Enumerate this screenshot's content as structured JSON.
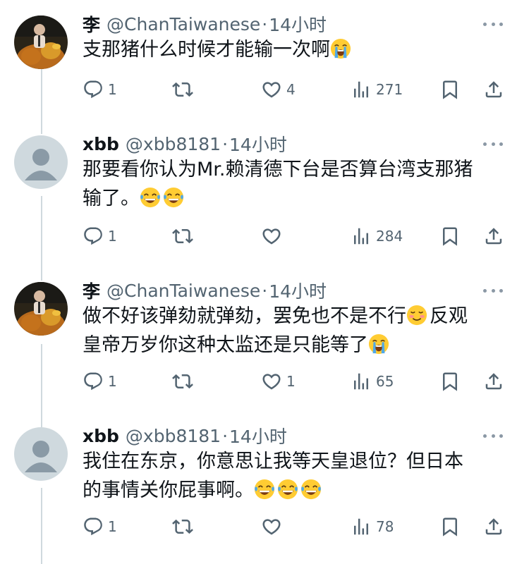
{
  "tweets": [
    {
      "name": "李",
      "handle": "@ChanTaiwanese",
      "separator": "·",
      "time": "14小时",
      "text": "支那猪什么时候才能输一次啊",
      "emojis": [
        "loudly-crying"
      ],
      "replies": "1",
      "retweets": "",
      "likes": "4",
      "views": "271",
      "avatar": "photo"
    },
    {
      "name": "xbb",
      "handle": "@xbb8181",
      "separator": "·",
      "time": "14小时",
      "text_line1": "那要看你认为Mr.赖清德下台是否算台湾支那猪",
      "text_line2": "输了。",
      "emojis": [
        "tears-of-joy",
        "tears-of-joy"
      ],
      "replies": "1",
      "retweets": "",
      "likes": "",
      "views": "284",
      "avatar": "default"
    },
    {
      "name": "李",
      "handle": "@ChanTaiwanese",
      "separator": "·",
      "time": "14小时",
      "text_line1a": "做不好该弹劾就弹劾，罢免也不是不行",
      "text_line1b": "反观",
      "text_line2": "皇帝万岁你这种太监还是只能等了",
      "emojis": [
        "smiling-blush",
        "loudly-crying"
      ],
      "replies": "1",
      "retweets": "",
      "likes": "1",
      "views": "65",
      "avatar": "photo"
    },
    {
      "name": "xbb",
      "handle": "@xbb8181",
      "separator": "·",
      "time": "14小时",
      "text_line1": "我住在东京，你意思让我等天皇退位？但日本",
      "text_line2": "的事情关你屁事啊。",
      "emojis": [
        "tears-of-joy",
        "tears-of-joy",
        "tears-of-joy"
      ],
      "replies": "1",
      "retweets": "",
      "likes": "",
      "views": "78",
      "avatar": "default"
    }
  ],
  "colors": {
    "text": "#0f1419",
    "secondary": "#536471",
    "icon": "#536471",
    "thread_line": "#cfd9de",
    "default_avatar_bg": "#cfd9de",
    "default_avatar_fg": "#8a9aa6"
  }
}
